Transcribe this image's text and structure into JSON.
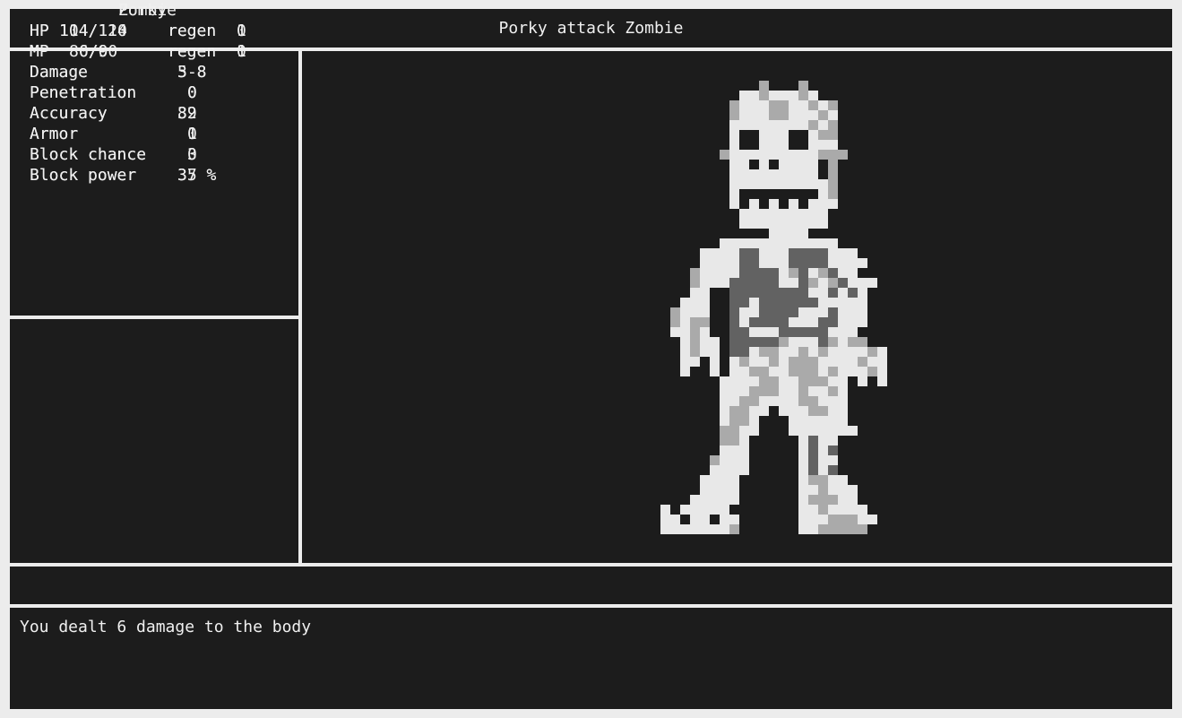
{
  "title": "Porky attack Zombie",
  "player": {
    "name": "Porky",
    "hp": "114/114",
    "hp_regen": "1",
    "mp": "86/90",
    "mp_regen": "1",
    "damage": "5-8",
    "penetration": "0",
    "accuracy": "89",
    "armor": "1",
    "block_chance": "3",
    "block_power": "37 %"
  },
  "enemy": {
    "name": "Zombie",
    "hp": "104/120",
    "hp_regen": "0",
    "mp": "0/0",
    "mp_regen": "0",
    "damage": "3-8",
    "penetration": "0",
    "accuracy": "32",
    "armor": "0",
    "block_chance": "0",
    "block_power": "35 %"
  },
  "labels": {
    "hp": "HP",
    "mp": "MP",
    "regen": "regen",
    "damage": "Damage",
    "penetration": "Penetration",
    "accuracy": "Accuracy",
    "armor": "Armor",
    "block_chance": "Block chance",
    "block_power": "Block power"
  },
  "log": [
    "You dealt 6 damage to the body"
  ],
  "sprite": {
    "name": "zombie-sprite",
    "palette": {
      "W": "#e8e8e8",
      "L": "#aaaaaa",
      "D": "#626262",
      "B": "#1c1c1c"
    }
  }
}
